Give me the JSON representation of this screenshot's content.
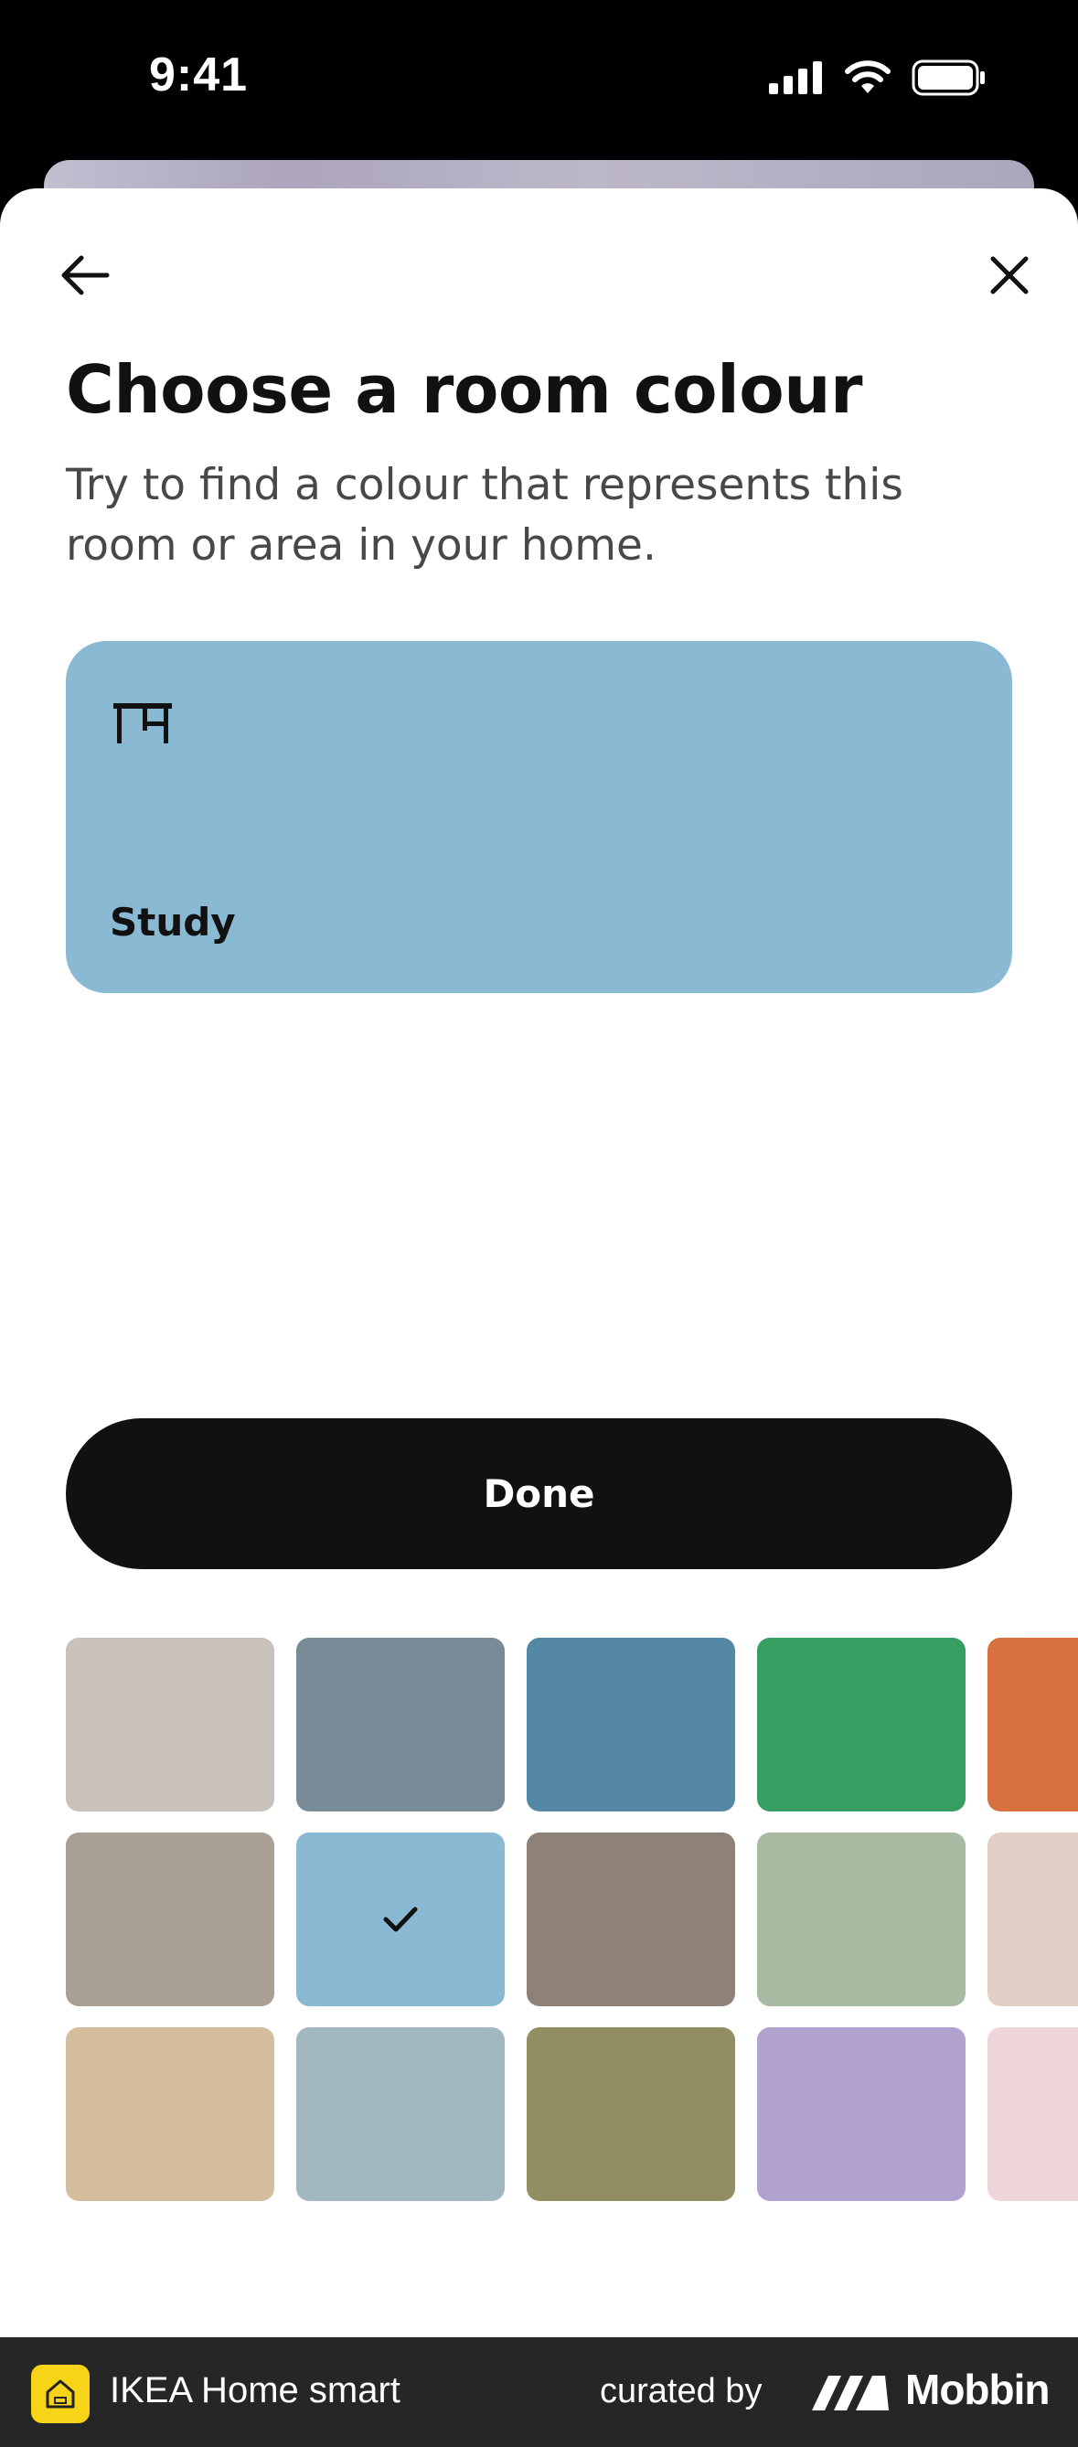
{
  "status_bar": {
    "time": "9:41"
  },
  "header": {
    "back_icon": "arrow-left-icon",
    "close_icon": "close-icon",
    "title": "Choose a room colour",
    "subtitle": "Try to find a colour that represents this room or area in your home."
  },
  "room_card": {
    "icon": "desk-icon",
    "name": "Study",
    "color": "#8ab9d4"
  },
  "done_button": {
    "label": "Done"
  },
  "swatches": {
    "selected": "#8ab9d4",
    "rows": [
      [
        "#c9c2ba",
        "#788b96",
        "#5488a5",
        "#379e61",
        "#d9703f"
      ],
      [
        "#a99f95",
        "#8ab9d4",
        "#8e8178",
        "#a8baa1",
        "#e4cfc7"
      ],
      [
        "#d3bd9c",
        "#a1b8c0",
        "#928d63",
        "#b0a2cc",
        "#efd4d9"
      ]
    ]
  },
  "footer": {
    "app_name": "IKEA Home smart",
    "curated_by": "curated by",
    "brand": "Mobbin"
  }
}
